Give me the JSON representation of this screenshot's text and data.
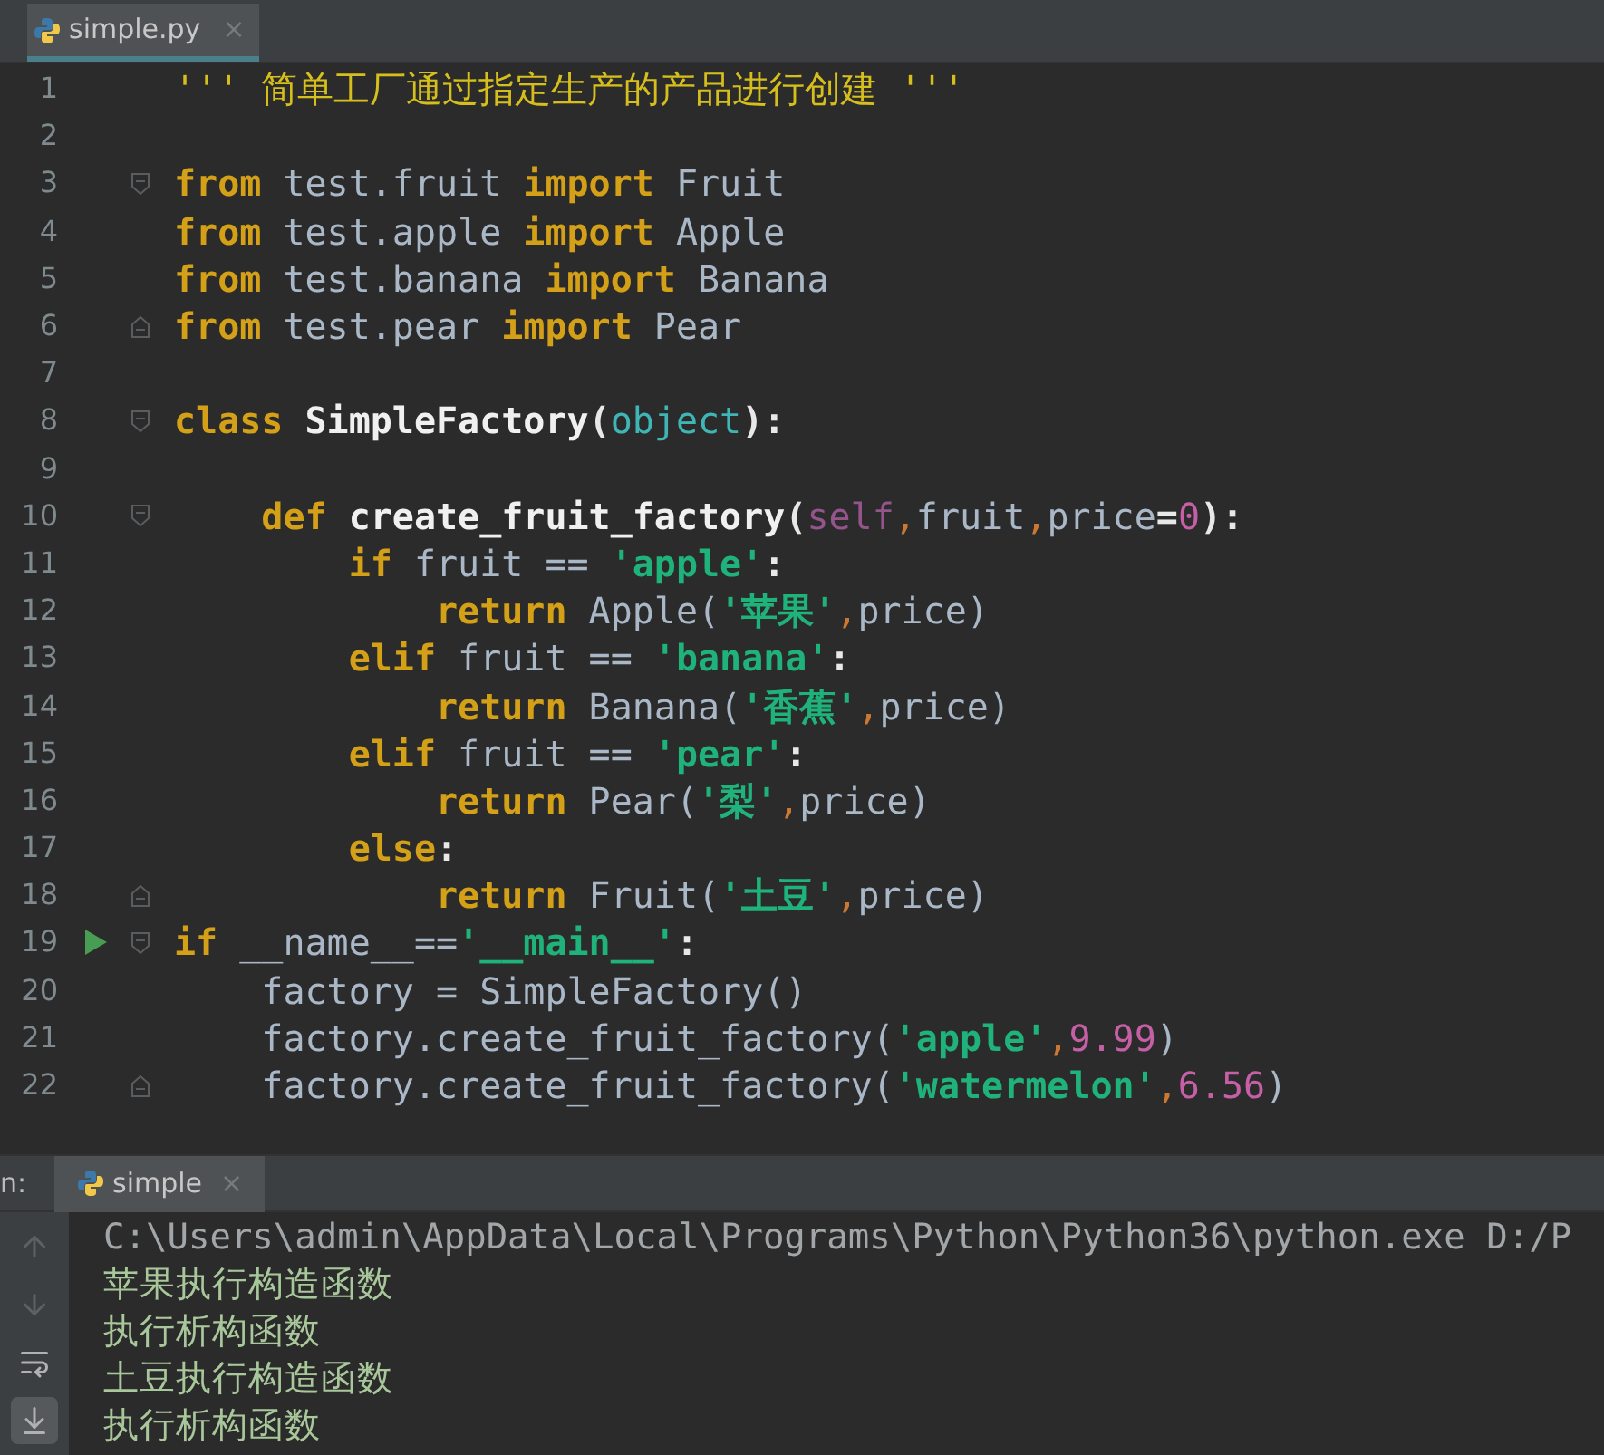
{
  "editor_tabs": [
    {
      "label": "simple.py",
      "close": "×",
      "selected": true
    }
  ],
  "editor": {
    "lines": [
      {
        "number": "1",
        "kind": "plain",
        "tokens": [
          {
            "kind": "doc",
            "text": "''' 简单工厂通过指定生产的产品进行创建 '''"
          }
        ]
      },
      {
        "number": "2",
        "kind": "plain"
      },
      {
        "number": "3",
        "kind": "fold-start",
        "tokens": [
          {
            "kind": "kw",
            "text": "from"
          },
          {
            "kind": "plain",
            "text": " test.fruit "
          },
          {
            "kind": "kw",
            "text": "import"
          },
          {
            "kind": "plain",
            "text": " Fruit"
          }
        ]
      },
      {
        "number": "4",
        "kind": "plain",
        "tokens": [
          {
            "kind": "kw",
            "text": "from"
          },
          {
            "kind": "plain",
            "text": " test.apple "
          },
          {
            "kind": "kw",
            "text": "import"
          },
          {
            "kind": "plain",
            "text": " Apple"
          }
        ]
      },
      {
        "number": "5",
        "kind": "plain",
        "tokens": [
          {
            "kind": "kw",
            "text": "from"
          },
          {
            "kind": "plain",
            "text": " test.banana "
          },
          {
            "kind": "kw",
            "text": "import"
          },
          {
            "kind": "plain",
            "text": " Banana"
          }
        ]
      },
      {
        "number": "6",
        "kind": "fold-end",
        "tokens": [
          {
            "kind": "kw",
            "text": "from"
          },
          {
            "kind": "plain",
            "text": " test.pear "
          },
          {
            "kind": "kw",
            "text": "import"
          },
          {
            "kind": "plain",
            "text": " Pear"
          }
        ]
      },
      {
        "number": "7",
        "kind": "plain"
      },
      {
        "number": "8",
        "kind": "fold-start",
        "tokens": [
          {
            "kind": "kw",
            "text": "class "
          },
          {
            "kind": "fn",
            "text": "SimpleFactory"
          },
          {
            "kind": "punct",
            "text": "("
          },
          {
            "kind": "builtin",
            "text": "object"
          },
          {
            "kind": "punct",
            "text": "):"
          }
        ]
      },
      {
        "number": "9",
        "kind": "plain"
      },
      {
        "number": "10",
        "kind": "fold-start",
        "tokens": [
          {
            "kind": "kw",
            "text": "    def "
          },
          {
            "kind": "fn",
            "text": "create_fruit_factory"
          },
          {
            "kind": "punct",
            "text": "("
          },
          {
            "kind": "self",
            "text": "self"
          },
          {
            "kind": "comma",
            "text": ","
          },
          {
            "kind": "plain",
            "text": "fruit"
          },
          {
            "kind": "comma",
            "text": ","
          },
          {
            "kind": "plain",
            "text": "price"
          },
          {
            "kind": "punct",
            "text": "="
          },
          {
            "kind": "num",
            "text": "0"
          },
          {
            "kind": "punct",
            "text": "):"
          }
        ]
      },
      {
        "number": "11",
        "kind": "plain",
        "tokens": [
          {
            "kind": "kw",
            "text": "        if"
          },
          {
            "kind": "plain",
            "text": " fruit == "
          },
          {
            "kind": "str",
            "text": "'apple'"
          },
          {
            "kind": "punct",
            "text": ":"
          }
        ]
      },
      {
        "number": "12",
        "kind": "plain",
        "tokens": [
          {
            "kind": "kw",
            "text": "            return"
          },
          {
            "kind": "plain",
            "text": " Apple("
          },
          {
            "kind": "str",
            "text": "'苹果'"
          },
          {
            "kind": "comma",
            "text": ","
          },
          {
            "kind": "plain",
            "text": "price)"
          }
        ]
      },
      {
        "number": "13",
        "kind": "plain",
        "tokens": [
          {
            "kind": "kw",
            "text": "        elif"
          },
          {
            "kind": "plain",
            "text": " fruit == "
          },
          {
            "kind": "str",
            "text": "'banana'"
          },
          {
            "kind": "punct",
            "text": ":"
          }
        ]
      },
      {
        "number": "14",
        "kind": "plain",
        "tokens": [
          {
            "kind": "kw",
            "text": "            return"
          },
          {
            "kind": "plain",
            "text": " Banana("
          },
          {
            "kind": "str",
            "text": "'香蕉'"
          },
          {
            "kind": "comma",
            "text": ","
          },
          {
            "kind": "plain",
            "text": "price)"
          }
        ]
      },
      {
        "number": "15",
        "kind": "plain",
        "tokens": [
          {
            "kind": "kw",
            "text": "        elif"
          },
          {
            "kind": "plain",
            "text": " fruit == "
          },
          {
            "kind": "str",
            "text": "'pear'"
          },
          {
            "kind": "punct",
            "text": ":"
          }
        ]
      },
      {
        "number": "16",
        "kind": "plain",
        "tokens": [
          {
            "kind": "kw",
            "text": "            return"
          },
          {
            "kind": "plain",
            "text": " Pear("
          },
          {
            "kind": "str",
            "text": "'梨'"
          },
          {
            "kind": "comma",
            "text": ","
          },
          {
            "kind": "plain",
            "text": "price)"
          }
        ]
      },
      {
        "number": "17",
        "kind": "plain",
        "tokens": [
          {
            "kind": "kw",
            "text": "        else"
          },
          {
            "kind": "punct",
            "text": ":"
          }
        ]
      },
      {
        "number": "18",
        "kind": "fold-end",
        "tokens": [
          {
            "kind": "kw",
            "text": "            return"
          },
          {
            "kind": "plain",
            "text": " Fruit("
          },
          {
            "kind": "str",
            "text": "'土豆'"
          },
          {
            "kind": "comma",
            "text": ","
          },
          {
            "kind": "plain",
            "text": "price)"
          }
        ]
      },
      {
        "number": "19",
        "kind": "run-fold-start",
        "tokens": [
          {
            "kind": "kw",
            "text": "if"
          },
          {
            "kind": "plain",
            "text": " __name__=="
          },
          {
            "kind": "str",
            "text": "'__main__'"
          },
          {
            "kind": "punct",
            "text": ":"
          }
        ]
      },
      {
        "number": "20",
        "kind": "plain",
        "tokens": [
          {
            "kind": "plain",
            "text": "    factory = SimpleFactory()"
          }
        ]
      },
      {
        "number": "21",
        "kind": "plain",
        "tokens": [
          {
            "kind": "plain",
            "text": "    factory.create_fruit_factory("
          },
          {
            "kind": "str",
            "text": "'apple'"
          },
          {
            "kind": "comma",
            "text": ","
          },
          {
            "kind": "num",
            "text": "9.99"
          },
          {
            "kind": "plain",
            "text": ")"
          }
        ]
      },
      {
        "number": "22",
        "kind": "fold-end",
        "tokens": [
          {
            "kind": "plain",
            "text": "    factory.create_fruit_factory("
          },
          {
            "kind": "str",
            "text": "'watermelon'"
          },
          {
            "kind": "comma",
            "text": ","
          },
          {
            "kind": "num",
            "text": "6.56"
          },
          {
            "kind": "plain",
            "text": ")"
          }
        ]
      }
    ]
  },
  "run_panel": {
    "label": "n:",
    "tabs": [
      {
        "label": "simple",
        "close": "×",
        "selected": true
      }
    ],
    "tools": [
      {
        "kind": "up",
        "disabled": true,
        "selected": false
      },
      {
        "kind": "down",
        "disabled": true,
        "selected": false
      },
      {
        "kind": "wrap",
        "disabled": false,
        "selected": false
      },
      {
        "kind": "scroll-end",
        "disabled": false,
        "selected": true
      }
    ],
    "output": [
      {
        "kind": "command",
        "text": "C:\\Users\\admin\\AppData\\Local\\Programs\\Python\\Python36\\python.exe D:/P"
      },
      {
        "kind": "stdout",
        "text": "苹果执行构造函数"
      },
      {
        "kind": "stdout",
        "text": "执行析构函数"
      },
      {
        "kind": "stdout",
        "text": "土豆执行构造函数"
      },
      {
        "kind": "stdout",
        "text": "执行析构函数"
      }
    ]
  }
}
